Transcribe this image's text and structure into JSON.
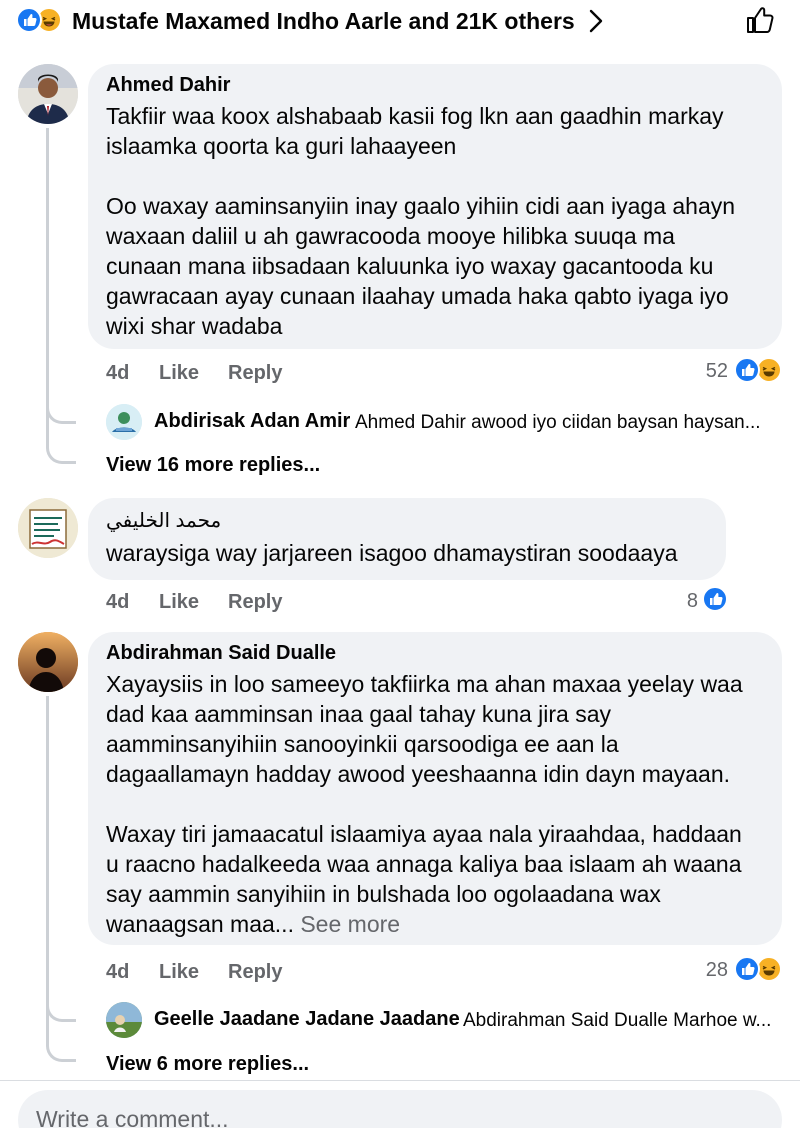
{
  "reactions_summary": {
    "text": "Mustafe Maxamed Indho Aarle and 21K others",
    "icons": [
      "like-icon",
      "haha-icon"
    ],
    "like_color": "#1877f2",
    "haha_color": "#f7b125"
  },
  "comments": [
    {
      "author": "Ahmed Dahir",
      "text": "Takfiir waa koox alshabaab kasii fog lkn aan gaadhin markay\nislaamka qoorta ka guri lahaayeen\n\nOo waxay aaminsanyiin inay gaalo yihiin cidi aan iyaga ahayn\nwaxaan daliil u ah gawracooda mooye hilibka suuqa ma\ncunaan mana iibsadaan kaluunka iyo waxay gacantooda ku\ngawracaan ayay cunaan ilaahay umada haka qabto iyaga iyo\nwixi shar wadaba",
      "time": "4d",
      "like_label": "Like",
      "reply_label": "Reply",
      "reaction_count": "52",
      "reply_preview": {
        "author": "Abdirisak Adan Amir",
        "text": "Ahmed Dahir  awood iyo ciidan baysan haysan..."
      },
      "view_more": "View 16 more replies..."
    },
    {
      "author": "محمد الخليفي",
      "text": "waraysiga way jarjareen isagoo dhamaystiran  soodaaya",
      "time": "4d",
      "like_label": "Like",
      "reply_label": "Reply",
      "reaction_count": "8"
    },
    {
      "author": "Abdirahman Said Dualle",
      "text": "Xayaysiis in loo sameeyo takfiirka ma ahan maxaa yeelay waa\ndad kaa aamminsan inaa gaal tahay kuna jira say\naamminsanyihiin sanooyinkii  qarsoodiga ee aan la\ndagaallamayn hadday awood yeeshaanna  idin dayn mayaan.\n\nWaxay tiri jamaacatul islaamiya ayaa nala yiraahdaa, haddaan\nu raacno hadalkeeda waa annaga kaliya baa islaam ah waana\nsay aammin sanyihiin  in bulshada loo ogolaadana wax\nwanaagsan maa...",
      "see_more": " See more",
      "time": "4d",
      "like_label": "Like",
      "reply_label": "Reply",
      "reaction_count": "28",
      "reply_preview": {
        "author": "Geelle Jaadane Jadane Jaadane",
        "text": "Abdirahman Said Dualle Marhoe w..."
      },
      "view_more": "View 6 more replies..."
    }
  ],
  "composer": {
    "placeholder": "Write a comment..."
  }
}
